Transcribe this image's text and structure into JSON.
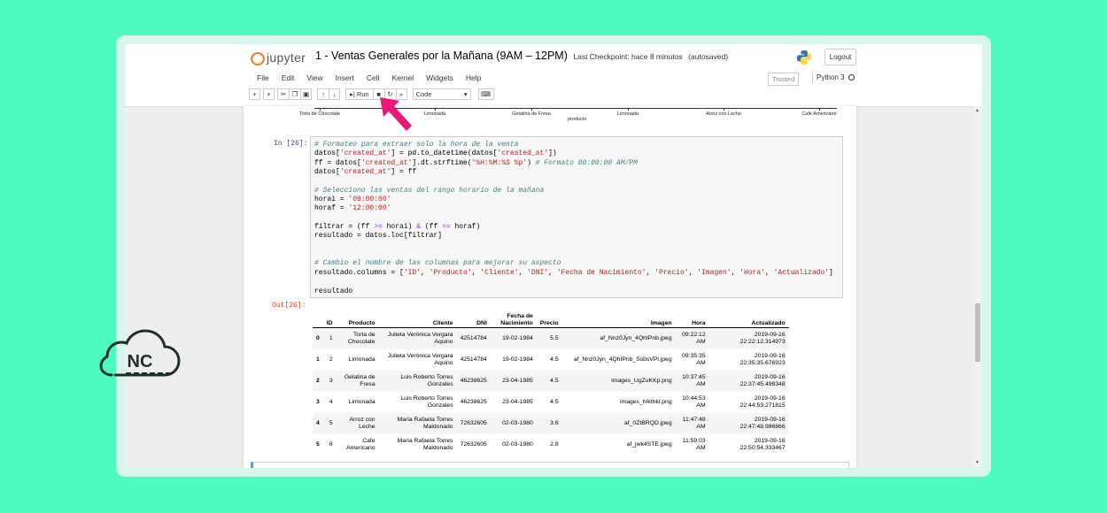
{
  "header": {
    "logo_text": "jupyter",
    "notebook_title": "1 - Ventas Generales por la Mañana (9AM – 12PM)",
    "checkpoint": "Last Checkpoint: hace 8 minutos",
    "autosave": "(autosaved)",
    "logout_label": "Logout"
  },
  "menu": [
    "File",
    "Edit",
    "View",
    "Insert",
    "Cell",
    "Kernel",
    "Widgets",
    "Help"
  ],
  "status": {
    "trusted": "Trusted",
    "kernel": "Python 3"
  },
  "toolbar": {
    "run_label": "Run",
    "cell_type": "Code"
  },
  "plot_axis": {
    "ticks": [
      "Torta de Chocolate",
      "Limonada",
      "Gelatina de Fresa",
      "Limonada",
      "Arroz con Leche",
      "Cafe Americano"
    ],
    "xlabel": "producto"
  },
  "cell": {
    "in_prompt": "In [26]:",
    "out_prompt": "Out[26]:",
    "code": [
      "# Formateo para extraer solo la hora de la venta",
      "datos['created_at'] = pd.to_datetime(datos['created_at'])",
      "ff = datos['created_at'].dt.strftime('%H:%M:%S %p') # Formato 00:00:00 AM/PM",
      "datos['created_at'] = ff",
      "",
      "# Selecciono las ventas del rango horario de la mañana",
      "horai = '09:00:00'",
      "horaf = '12:00:00'",
      "",
      "filtrar = (ff >= horai) & (ff <= horaf)",
      "resultado = datos.loc[filtrar]",
      "",
      "",
      "# Cambio el nombre de las columnas para mejorar su aspecto",
      "resultado.columns = ['ID', 'Producto', 'Cliente', 'DNI', 'Fecha de Nacimiento', 'Precio', 'Imagen', 'Hora', 'Actualizado']",
      "",
      "resultado"
    ]
  },
  "table": {
    "columns": [
      "ID",
      "Producto",
      "Cliente",
      "DNI",
      "Fecha de Nacimiento",
      "Precio",
      "Imagen",
      "Hora",
      "Actualizado"
    ],
    "rows": [
      {
        "index": "0",
        "cells": [
          "1",
          "Torta de Chocolate",
          "Julieta Verónica Vergara Aquino",
          "42514784",
          "19-02-1984",
          "5.5",
          "af_Nnz0Jyn_4QhIPnb.jpeg",
          "09:22:12 AM",
          "2019-09-16 22:22:12.314973"
        ]
      },
      {
        "index": "1",
        "cells": [
          "2",
          "Limonada",
          "Julieta Verónica Vergara Aquino",
          "42514784",
          "19-02-1984",
          "4.5",
          "af_Nnz0Jyn_4QhIPnb_SsbsVPl.jpeg",
          "09:35:35 AM",
          "2019-09-16 22:35:35.676923"
        ]
      },
      {
        "index": "2",
        "cells": [
          "3",
          "Gelatina de Fresa",
          "Luis Roberto Torres Gonzales",
          "46238625",
          "23-04-1985",
          "4.5",
          "images_UgZuKKp.png",
          "10:37:45 AM",
          "2019-09-16 22:37:45.498348"
        ]
      },
      {
        "index": "3",
        "cells": [
          "4",
          "Limonada",
          "Luis Roberto Torres Gonzales",
          "46238625",
          "23-04-1985",
          "4.5",
          "images_hIkthkl.png",
          "10:44:53 AM",
          "2019-09-16 22:44:53.271815"
        ]
      },
      {
        "index": "4",
        "cells": [
          "5",
          "Arroz con Leche",
          "Maria Rafaela Torres Maldonado",
          "72632605",
          "02-03-1980",
          "3.6",
          "af_0ZtBRQD.jpeg",
          "11:47:48 AM",
          "2019-09-16 22:47:48.986866"
        ]
      },
      {
        "index": "5",
        "cells": [
          "6",
          "Cafe Americano",
          "Maria Rafaela Torres Maldonado",
          "72632605",
          "02-03-1980",
          "2.8",
          "af_jwk4STE.jpeg",
          "11:59:03 AM",
          "2019-09-16 22:50:54.333467"
        ]
      }
    ]
  },
  "watermark": {
    "text": "NC"
  },
  "colors": {
    "background": "#4dfbc0",
    "accent_arrow": "#e8197a",
    "jupyter_orange": "#f37726",
    "prompt_in": "#303f9f",
    "prompt_out": "#d84315"
  }
}
